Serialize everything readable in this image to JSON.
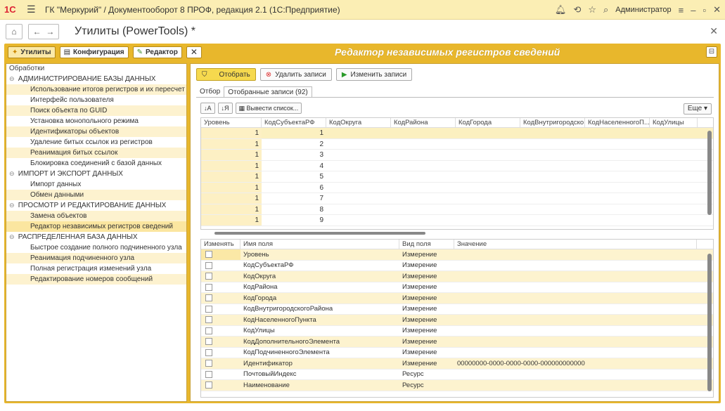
{
  "window": {
    "logo": "1C",
    "title": "ГК \"Меркурий\" / Документооборот 8 ПРОФ, редакция 2.1  (1С:Предприятие)",
    "user": "Администратор"
  },
  "nav": {
    "page_title": "Утилиты (PowerTools) *"
  },
  "frame": {
    "tools": [
      "Утилиты",
      "Конфигурация",
      "Редактор"
    ],
    "title": "Редактор независимых регистров сведений"
  },
  "left": {
    "header": "Обработки",
    "groups": [
      {
        "label": "АДМИНИСТРИРОВАНИЕ БАЗЫ ДАННЫХ",
        "items": [
          "Использование итогов регистров и их пересчет",
          "Интерфейс пользователя",
          "Поиск объекта по GUID",
          "Установка монопольного режима",
          "Идентификаторы объектов",
          "Удаление битых ссылок из регистров",
          "Реанимация битых ссылок",
          "Блокировка соединений с базой данных"
        ]
      },
      {
        "label": "ИМПОРТ И ЭКСПОРТ ДАННЫХ",
        "items": [
          "Импорт данных",
          "Обмен данными"
        ]
      },
      {
        "label": "ПРОСМОТР И РЕДАКТИРОВАНИЕ ДАННЫХ",
        "items": [
          "Замена объектов",
          "Редактор независимых регистров сведений"
        ]
      },
      {
        "label": "РАСПРЕДЕЛЕННАЯ БАЗА ДАННЫХ",
        "items": [
          "Быстрое создание полного подчиненного узла",
          "Реанимация подчиненного узла",
          "Полная регистрация изменений узла",
          "Редактирование номеров сообщений"
        ]
      }
    ]
  },
  "right": {
    "buttons": {
      "filter": "Отобрать",
      "delete": "Удалить записи",
      "change": "Изменить записи"
    },
    "tabs": [
      "Отбор",
      "Отобранные записи (92)"
    ],
    "subtools": {
      "output_list": "Вывести список...",
      "more": "Еще"
    },
    "grid1": {
      "columns": [
        "Уровень",
        "КодСубъектаРФ",
        "КодОкруга",
        "КодРайона",
        "КодГорода",
        "КодВнутригородско...",
        "КодНаселенногоП...",
        "КодУлицы"
      ],
      "rows": [
        [
          "1",
          "1"
        ],
        [
          "1",
          "2"
        ],
        [
          "1",
          "3"
        ],
        [
          "1",
          "4"
        ],
        [
          "1",
          "5"
        ],
        [
          "1",
          "6"
        ],
        [
          "1",
          "7"
        ],
        [
          "1",
          "8"
        ],
        [
          "1",
          "9"
        ]
      ]
    },
    "grid2": {
      "columns": [
        "Изменять",
        "Имя поля",
        "Вид поля",
        "Значение"
      ],
      "rows": [
        [
          "Уровень",
          "Измерение",
          ""
        ],
        [
          "КодСубъектаРФ",
          "Измерение",
          ""
        ],
        [
          "КодОкруга",
          "Измерение",
          ""
        ],
        [
          "КодРайона",
          "Измерение",
          ""
        ],
        [
          "КодГорода",
          "Измерение",
          ""
        ],
        [
          "КодВнутригородскогоРайона",
          "Измерение",
          ""
        ],
        [
          "КодНаселенногоПункта",
          "Измерение",
          ""
        ],
        [
          "КодУлицы",
          "Измерение",
          ""
        ],
        [
          "КодДополнительногоЭлемента",
          "Измерение",
          ""
        ],
        [
          "КодПодчиненногоЭлемента",
          "Измерение",
          ""
        ],
        [
          "Идентификатор",
          "Измерение",
          "00000000-0000-0000-0000-000000000000"
        ],
        [
          "ПочтовыйИндекс",
          "Ресурс",
          ""
        ],
        [
          "Наименование",
          "Ресурс",
          ""
        ]
      ]
    }
  }
}
